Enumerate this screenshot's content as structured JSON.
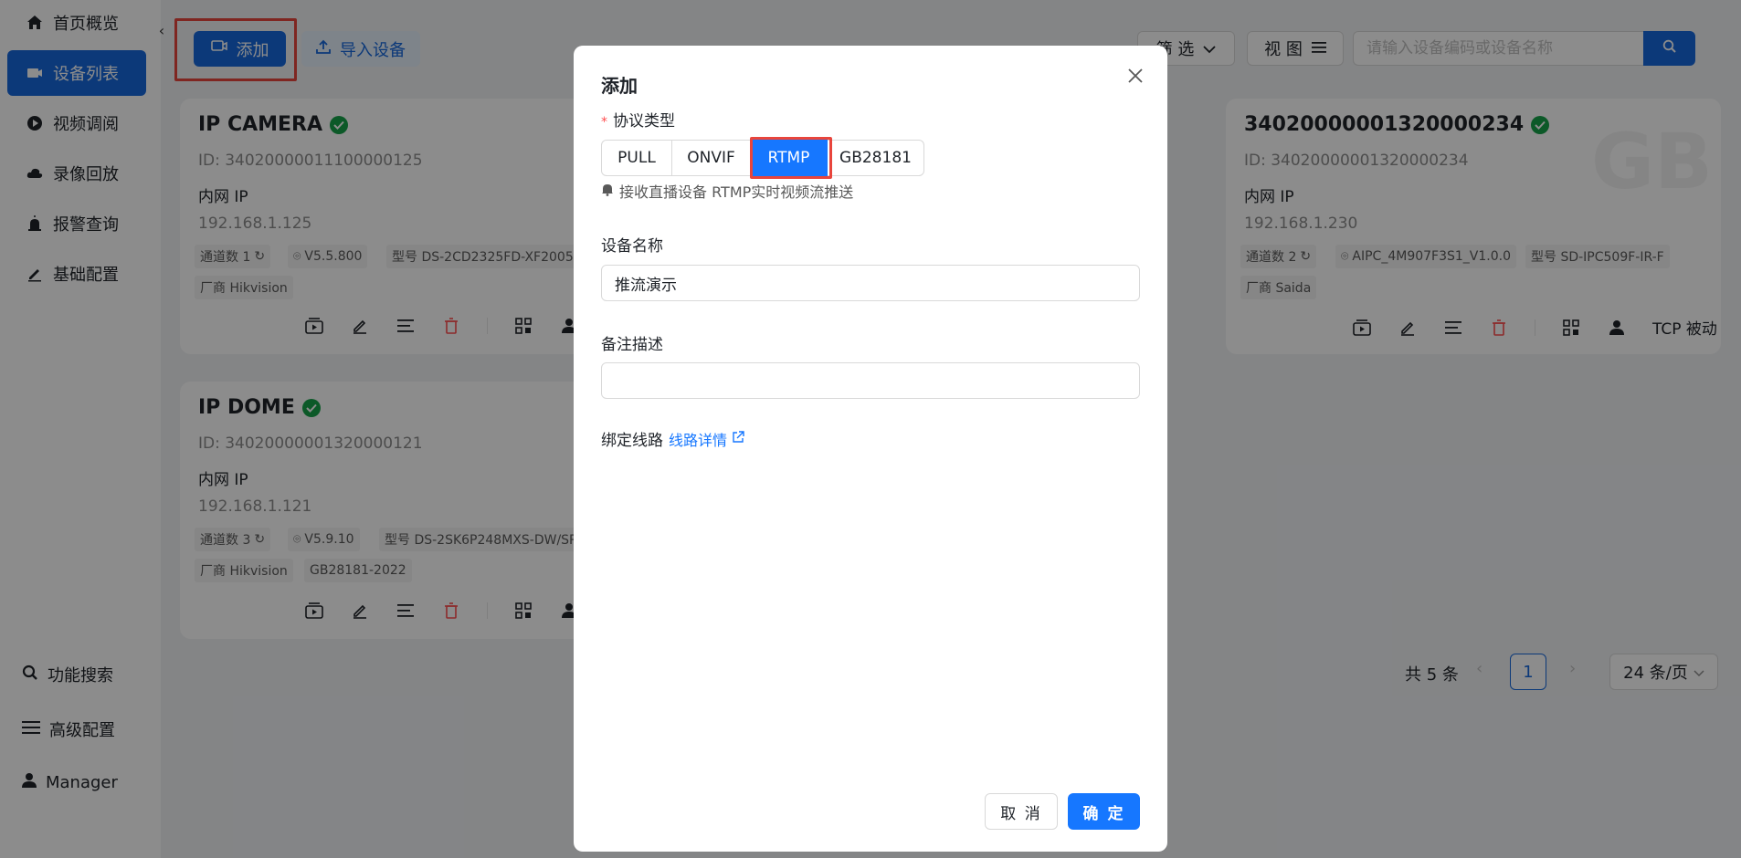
{
  "sidebar": {
    "items": [
      {
        "label": "首页概览",
        "icon": "home-icon"
      },
      {
        "label": "设备列表",
        "icon": "device-icon",
        "active": true
      },
      {
        "label": "视频调阅",
        "icon": "play-icon"
      },
      {
        "label": "录像回放",
        "icon": "cloud-icon"
      },
      {
        "label": "报警查询",
        "icon": "alarm-icon"
      },
      {
        "label": "基础配置",
        "icon": "edit-icon"
      }
    ],
    "bottom": [
      {
        "label": "功能搜索",
        "icon": "search-icon"
      },
      {
        "label": "高级配置",
        "icon": "menu-icon"
      },
      {
        "label": "Manager",
        "icon": "user-icon"
      }
    ]
  },
  "toolbar": {
    "add_label": "添加",
    "import_label": "导入设备",
    "filter_label": "筛 选",
    "view_label": "视 图",
    "search_placeholder": "请输入设备编码或设备名称"
  },
  "cards": [
    {
      "title": "IP CAMERA",
      "id": "ID: 34020000011100000125",
      "net_label": "内网 IP",
      "ip": "192.168.1.125",
      "tags": [
        "通道数 1",
        "V5.5.800",
        "型号 DS-2CD2325FD-XF2005"
      ],
      "tags2": [
        "厂商 Hikvision"
      ]
    },
    {
      "title": "34020000001320000234",
      "id": "ID: 34020000001320000234",
      "net_label": "内网 IP",
      "ip": "192.168.1.230",
      "tags": [
        "通道数 2",
        "AIPC_4M907F3S1_V1.0.0",
        "型号 SD-IPC509F-IR-F"
      ],
      "tags2": [
        "厂商 Saida"
      ],
      "transport": "TCP 被动",
      "watermark": "GB"
    },
    {
      "title": "IP DOME",
      "id": "ID: 34020000001320000121",
      "net_label": "内网 IP",
      "ip": "192.168.1.121",
      "tags": [
        "通道数 3",
        "V5.9.10",
        "型号 DS-2SK6P248MXS-DW/SP"
      ],
      "tags2": [
        "厂商 Hikvision",
        "GB28181-2022"
      ]
    }
  ],
  "pagination": {
    "total": "共 5 条",
    "page": "1",
    "page_size": "24 条/页"
  },
  "modal": {
    "title": "添加",
    "protocol_label": "协议类型",
    "protocols": [
      "PULL",
      "ONVIF",
      "RTMP",
      "GB28181"
    ],
    "selected_protocol": "RTMP",
    "hint": "接收直播设备 RTMP实时视频流推送",
    "name_label": "设备名称",
    "name_value": "推流演示",
    "remark_label": "备注描述",
    "remark_value": "",
    "bind_label": "绑定线路",
    "bind_link": "线路详情",
    "cancel": "取 消",
    "ok": "确 定"
  },
  "colors": {
    "primary": "#1668dc",
    "success": "#16a34a",
    "danger": "#ff4d4f",
    "highlight": "#e8453c"
  }
}
